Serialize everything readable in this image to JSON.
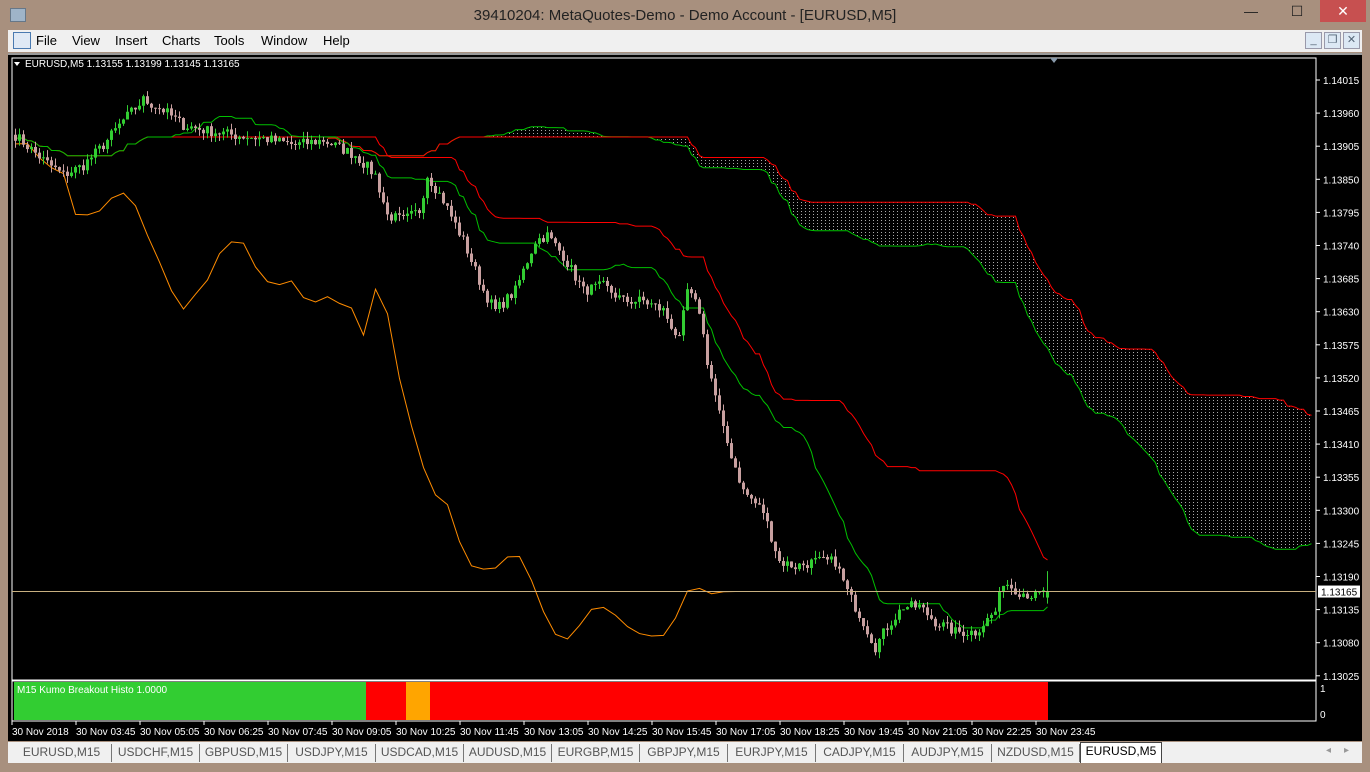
{
  "window": {
    "title": "39410204: MetaQuotes-Demo - Demo Account - [EURUSD,M5]",
    "minimize": "—",
    "maximize": "☐",
    "close": "✕"
  },
  "menu": [
    "File",
    "View",
    "Insert",
    "Charts",
    "Tools",
    "Window",
    "Help"
  ],
  "mdi": {
    "minimize": "_",
    "restore": "❐",
    "close": "✕"
  },
  "chart": {
    "header": "EURUSD,M5  1.13155 1.13199 1.13145 1.13165",
    "current_price": "1.13165",
    "price_labels": [
      "1.14015",
      "1.13960",
      "1.13905",
      "1.13850",
      "1.13795",
      "1.13740",
      "1.13685",
      "1.13630",
      "1.13575",
      "1.13520",
      "1.13465",
      "1.13410",
      "1.13355",
      "1.13300",
      "1.13245",
      "1.13190",
      "1.13135",
      "1.13080",
      "1.13025"
    ],
    "time_labels": [
      "30 Nov 2018",
      "30 Nov 03:45",
      "30 Nov 05:05",
      "30 Nov 06:25",
      "30 Nov 07:45",
      "30 Nov 09:05",
      "30 Nov 10:25",
      "30 Nov 11:45",
      "30 Nov 13:05",
      "30 Nov 14:25",
      "30 Nov 15:45",
      "30 Nov 17:05",
      "30 Nov 18:25",
      "30 Nov 19:45",
      "30 Nov 21:05",
      "30 Nov 22:25",
      "30 Nov 23:45"
    ],
    "colors": {
      "bull": "#32cd32",
      "bear": "#c8a0a0",
      "tenkan": "#ff0000",
      "kijun": "#00c000",
      "senkou_a": "#00c000",
      "senkou_b": "#ff0000",
      "chikou": "#ff8c00",
      "cloud": "#bbbbbb"
    }
  },
  "indicator": {
    "label": "M15 Kumo Breakout Histo 1.0000",
    "scale": [
      "1",
      "0"
    ],
    "segments": [
      {
        "from": "02:25",
        "to": "09:45",
        "color": "#32cd32"
      },
      {
        "from": "09:45",
        "to": "10:35",
        "color": "#ff0000"
      },
      {
        "from": "10:35",
        "to": "11:05",
        "color": "#ffa500"
      },
      {
        "from": "11:05",
        "to": "23:55",
        "color": "#ff0000"
      }
    ]
  },
  "chart_data": {
    "type": "candlestick",
    "symbol": "EURUSD",
    "timeframe": "M5",
    "ylim": [
      1.13,
      1.1406
    ],
    "close_path": [
      [
        "02:25",
        1.13923
      ],
      [
        "03:00",
        1.13882
      ],
      [
        "03:25",
        1.13857
      ],
      [
        "03:50",
        1.13873
      ],
      [
        "04:15",
        1.13907
      ],
      [
        "04:40",
        1.13948
      ],
      [
        "05:05",
        1.13982
      ],
      [
        "05:30",
        1.13965
      ],
      [
        "05:55",
        1.1394
      ],
      [
        "06:20",
        1.13932
      ],
      [
        "07:00",
        1.13923
      ],
      [
        "07:35",
        1.13918
      ],
      [
        "08:15",
        1.13907
      ],
      [
        "08:50",
        1.13915
      ],
      [
        "09:30",
        1.1389
      ],
      [
        "09:55",
        1.13857
      ],
      [
        "10:10",
        1.1379
      ],
      [
        "10:30",
        1.13782
      ],
      [
        "10:50",
        1.13798
      ],
      [
        "11:00",
        1.13857
      ],
      [
        "11:20",
        1.13815
      ],
      [
        "11:45",
        1.13748
      ],
      [
        "12:10",
        1.13665
      ],
      [
        "12:25",
        1.13632
      ],
      [
        "12:50",
        1.13665
      ],
      [
        "13:15",
        1.13748
      ],
      [
        "13:30",
        1.13757
      ],
      [
        "13:50",
        1.13723
      ],
      [
        "14:15",
        1.13665
      ],
      [
        "14:40",
        1.13673
      ],
      [
        "15:05",
        1.13648
      ],
      [
        "15:30",
        1.13648
      ],
      [
        "15:55",
        1.13632
      ],
      [
        "16:15",
        1.13582
      ],
      [
        "16:25",
        1.13665
      ],
      [
        "16:40",
        1.13632
      ],
      [
        "16:50",
        1.13548
      ],
      [
        "17:10",
        1.13432
      ],
      [
        "17:35",
        1.13332
      ],
      [
        "18:00",
        1.13298
      ],
      [
        "18:20",
        1.13215
      ],
      [
        "18:40",
        1.13207
      ],
      [
        "19:05",
        1.13215
      ],
      [
        "19:30",
        1.13215
      ],
      [
        "19:45",
        1.13165
      ],
      [
        "20:05",
        1.13115
      ],
      [
        "20:20",
        1.13073
      ],
      [
        "20:35",
        1.13107
      ],
      [
        "20:55",
        1.1314
      ],
      [
        "21:15",
        1.1314
      ],
      [
        "21:35",
        1.13115
      ],
      [
        "22:00",
        1.13098
      ],
      [
        "22:25",
        1.13098
      ],
      [
        "22:50",
        1.13132
      ],
      [
        "23:00",
        1.13182
      ],
      [
        "23:20",
        1.13165
      ],
      [
        "23:40",
        1.13157
      ],
      [
        "23:55",
        1.13165
      ]
    ]
  },
  "tabs": [
    "EURUSD,M15",
    "USDCHF,M15",
    "GBPUSD,M15",
    "USDJPY,M15",
    "USDCAD,M15",
    "AUDUSD,M15",
    "EURGBP,M15",
    "GBPJPY,M15",
    "EURJPY,M15",
    "CADJPY,M15",
    "AUDJPY,M15",
    "NZDUSD,M15",
    "EURUSD,M5"
  ],
  "active_tab": "EURUSD,M5",
  "tab_scroll": {
    "left": "◂",
    "right": "▸"
  }
}
